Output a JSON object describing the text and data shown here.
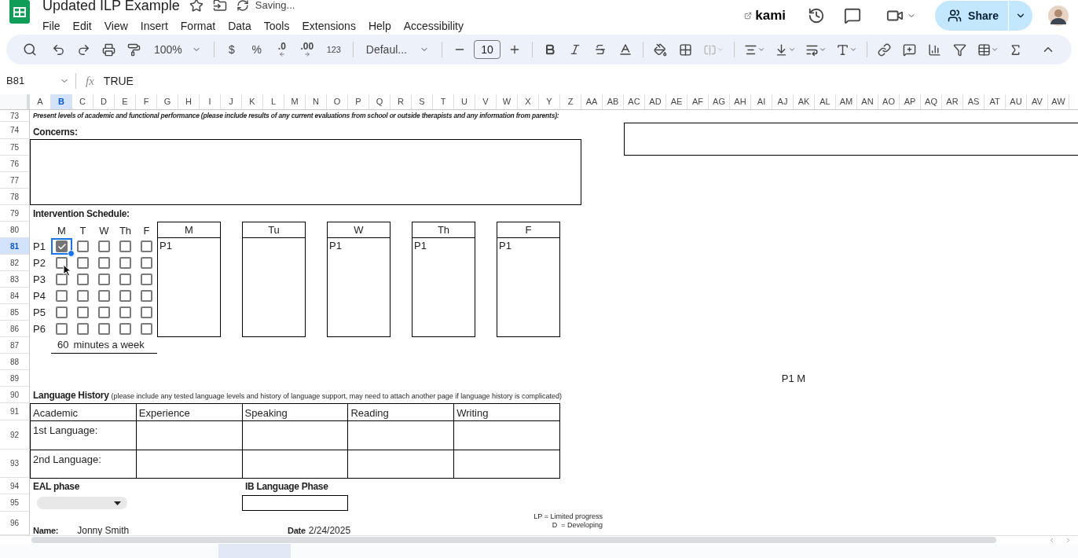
{
  "app": {
    "title": "Updated ILP Example",
    "status": "Saving...",
    "kami": "kami",
    "share": "Share",
    "menu": [
      "File",
      "Edit",
      "View",
      "Insert",
      "Format",
      "Data",
      "Tools",
      "Extensions",
      "Help",
      "Accessibility"
    ]
  },
  "toolbar": {
    "zoom": "100%",
    "currency": "$",
    "percent": "%",
    "decrease_decimal": ".0",
    "increase_decimal": ".00",
    "number_format": "123",
    "font": "Defaul...",
    "font_size": "10"
  },
  "formula_bar": {
    "cell": "B81",
    "fx": "fx",
    "value": "TRUE"
  },
  "columns": [
    {
      "label": "A",
      "selected": false
    },
    {
      "label": "B",
      "selected": true
    },
    {
      "label": "C",
      "selected": false
    },
    {
      "label": "D",
      "selected": false
    },
    {
      "label": "E",
      "selected": false
    },
    {
      "label": "F",
      "selected": false
    },
    {
      "label": "G",
      "selected": false
    },
    {
      "label": "H",
      "selected": false
    },
    {
      "label": "I",
      "selected": false
    },
    {
      "label": "J",
      "selected": false
    },
    {
      "label": "K",
      "selected": false
    },
    {
      "label": "L",
      "selected": false
    },
    {
      "label": "M",
      "selected": false
    },
    {
      "label": "N",
      "selected": false
    },
    {
      "label": "O",
      "selected": false
    },
    {
      "label": "P",
      "selected": false
    },
    {
      "label": "Q",
      "selected": false
    },
    {
      "label": "R",
      "selected": false
    },
    {
      "label": "S",
      "selected": false
    },
    {
      "label": "T",
      "selected": false
    },
    {
      "label": "U",
      "selected": false
    },
    {
      "label": "V",
      "selected": false
    },
    {
      "label": "W",
      "selected": false
    },
    {
      "label": "X",
      "selected": false
    },
    {
      "label": "Y",
      "selected": false
    },
    {
      "label": "Z",
      "selected": false
    },
    {
      "label": "AA",
      "selected": false
    },
    {
      "label": "AB",
      "selected": false
    },
    {
      "label": "AC",
      "selected": false
    },
    {
      "label": "AD",
      "selected": false
    },
    {
      "label": "AE",
      "selected": false
    },
    {
      "label": "AF",
      "selected": false
    },
    {
      "label": "AG",
      "selected": false
    },
    {
      "label": "AH",
      "selected": false
    },
    {
      "label": "AI",
      "selected": false
    },
    {
      "label": "AJ",
      "selected": false
    },
    {
      "label": "AK",
      "selected": false
    },
    {
      "label": "AL",
      "selected": false
    },
    {
      "label": "AM",
      "selected": false
    },
    {
      "label": "AN",
      "selected": false
    },
    {
      "label": "AO",
      "selected": false
    },
    {
      "label": "AP",
      "selected": false
    },
    {
      "label": "AQ",
      "selected": false
    },
    {
      "label": "AR",
      "selected": false
    },
    {
      "label": "AS",
      "selected": false
    },
    {
      "label": "AT",
      "selected": false
    },
    {
      "label": "AU",
      "selected": false
    },
    {
      "label": "AV",
      "selected": false
    },
    {
      "label": "AW",
      "selected": false
    }
  ],
  "rows": [
    {
      "label": "73",
      "selected": false
    },
    {
      "label": "74",
      "selected": false
    },
    {
      "label": "75",
      "selected": false
    },
    {
      "label": "76",
      "selected": false
    },
    {
      "label": "77",
      "selected": false
    },
    {
      "label": "78",
      "selected": false
    },
    {
      "label": "79",
      "selected": false
    },
    {
      "label": "80",
      "selected": false
    },
    {
      "label": "81",
      "selected": true
    },
    {
      "label": "82",
      "selected": false
    },
    {
      "label": "83",
      "selected": false
    },
    {
      "label": "84",
      "selected": false
    },
    {
      "label": "85",
      "selected": false
    },
    {
      "label": "86",
      "selected": false
    },
    {
      "label": "87",
      "selected": false
    },
    {
      "label": "88",
      "selected": false
    },
    {
      "label": "89",
      "selected": false
    },
    {
      "label": "90",
      "selected": false
    },
    {
      "label": "91",
      "selected": false
    },
    {
      "label": "92",
      "selected": false
    },
    {
      "label": "93",
      "selected": false
    },
    {
      "label": "94",
      "selected": false
    },
    {
      "label": "95",
      "selected": false
    },
    {
      "label": "96",
      "selected": false
    }
  ],
  "sheet": {
    "performance_note": "Present levels of academic and functional performance (please include results of any current evaluations from school or outside therapists and any information from parents):",
    "concerns_label": "Concerns:",
    "schedule": {
      "title": "Intervention Schedule:",
      "day_headers": [
        "M",
        "T",
        "W",
        "Th",
        "F"
      ],
      "periods": [
        {
          "label": "P1",
          "checks": [
            true,
            false,
            false,
            false,
            false
          ]
        },
        {
          "label": "P2",
          "checks": [
            false,
            false,
            false,
            false,
            false
          ]
        },
        {
          "label": "P3",
          "checks": [
            false,
            false,
            false,
            false,
            false
          ]
        },
        {
          "label": "P4",
          "checks": [
            false,
            false,
            false,
            false,
            false
          ]
        },
        {
          "label": "P5",
          "checks": [
            false,
            false,
            false,
            false,
            false
          ]
        },
        {
          "label": "P6",
          "checks": [
            false,
            false,
            false,
            false,
            false
          ]
        }
      ],
      "minutes": "60",
      "minutes_label": "minutes a week",
      "days": [
        {
          "name": "M",
          "entries": [
            "P1"
          ]
        },
        {
          "name": "Tu"
        },
        {
          "name": "W",
          "entries": [
            "P1"
          ]
        },
        {
          "name": "Th",
          "entries": [
            "P1"
          ]
        },
        {
          "name": "F",
          "entries": [
            "P1"
          ]
        }
      ]
    },
    "side_note": "P1 M",
    "language_history": {
      "title": "Language History",
      "note": "(please include any tested language levels and history of language support, may need to attach another page if language history is complicated)",
      "columns": [
        "Academic",
        "Experience",
        "Speaking",
        "Reading",
        "Writing"
      ],
      "rows": [
        "1st Language:",
        "2nd Language:"
      ]
    },
    "eal_phase_label": "EAL phase",
    "ib_phase_label": "IB Language Phase",
    "legend": [
      "LP = Limited progress",
      "D  = Developing"
    ],
    "footer": {
      "name_label": "Name:",
      "name": "Jonny Smith",
      "date_label": "Date",
      "date": "2/24/2025"
    }
  }
}
